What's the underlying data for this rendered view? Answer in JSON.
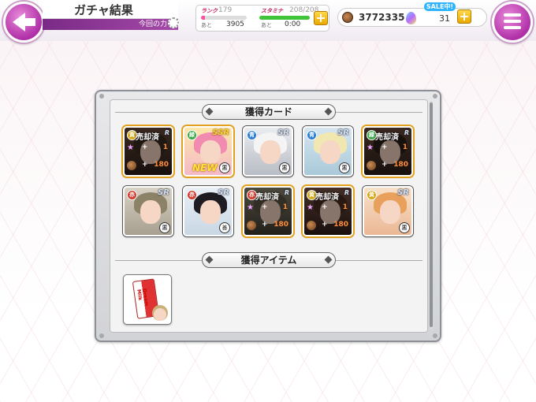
{
  "header": {
    "title": "ガチャ結果",
    "subtitle": "今回の力"
  },
  "status": {
    "rank_label": "ランク",
    "rank_value": "179",
    "rank_next_label": "あと",
    "rank_next_value": "3905",
    "stamina_label": "スタミナ",
    "stamina_value": "208/208",
    "stamina_next_label": "あと",
    "stamina_next_value": "0:00",
    "coins": "3772335",
    "gems": "31",
    "sale_label": "SALE中!"
  },
  "sections": {
    "cards_title": "獲得カード",
    "items_title": "獲得アイテム"
  },
  "colors": {
    "accent_purple": "#a83aa8",
    "rank_gauge": "#ff4fa2",
    "stamina_gauge": "#3fc43a",
    "gold": "#e2a21f"
  },
  "cards": [
    {
      "rarity": "R",
      "sold_label": "売却済",
      "star_plus": "+",
      "star_value": "1",
      "coin_plus": "+",
      "coin_value": "180",
      "element": "黄",
      "seal": "悪"
    },
    {
      "rarity": "SSR",
      "new_label": "NEW",
      "element": "緑",
      "seal": "悪"
    },
    {
      "rarity": "SR",
      "element": "青",
      "seal": "悪"
    },
    {
      "rarity": "SR",
      "element": "青",
      "seal": "悪"
    },
    {
      "rarity": "R",
      "sold_label": "売却済",
      "star_plus": "+",
      "star_value": "1",
      "coin_plus": "+",
      "coin_value": "180",
      "element": "緑",
      "seal": "悪"
    },
    {
      "rarity": "SR",
      "element": "赤",
      "seal": "悪"
    },
    {
      "rarity": "SR",
      "element": "赤",
      "seal": "善"
    },
    {
      "rarity": "R",
      "sold_label": "売却済",
      "star_plus": "+",
      "star_value": "1",
      "coin_plus": "+",
      "coin_value": "180",
      "element": "赤",
      "seal": "悪"
    },
    {
      "rarity": "R",
      "sold_label": "売却済",
      "star_plus": "+",
      "star_value": "1",
      "coin_plus": "+",
      "coin_value": "180",
      "element": "黄",
      "seal": "悪"
    },
    {
      "rarity": "SR",
      "element": "黄",
      "seal": "悪"
    }
  ],
  "items": [
    {
      "name": "Dream Milk",
      "icon": "milk-pack-icon"
    }
  ]
}
